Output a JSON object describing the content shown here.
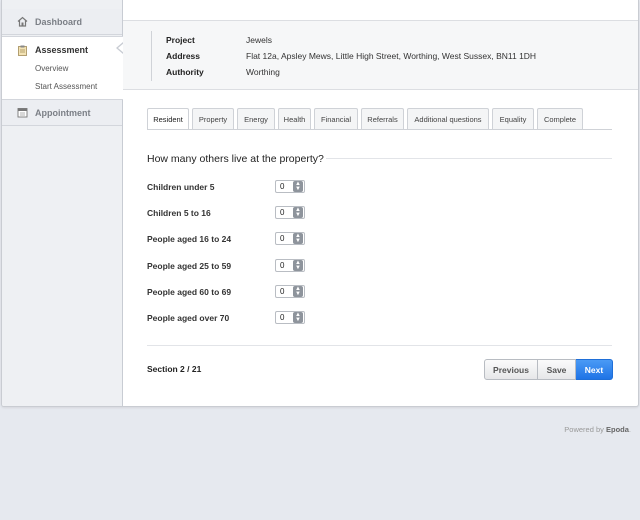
{
  "sidebar": {
    "items": [
      {
        "label": "Dashboard",
        "icon": "house-icon"
      },
      {
        "label": "Assessment",
        "icon": "clipboard-icon"
      },
      {
        "label": "Appointment",
        "icon": "calendar-icon"
      }
    ],
    "sub_items": [
      "Overview",
      "Start Assessment"
    ]
  },
  "info": {
    "project_label": "Project",
    "project_value": "Jewels",
    "address_label": "Address",
    "address_value": "Flat 12a, Apsley Mews, Little High Street, Worthing, West Sussex, BN11 1DH",
    "authority_label": "Authority",
    "authority_value": "Worthing"
  },
  "tabs": [
    "Resident",
    "Property",
    "Energy",
    "Health",
    "Financial",
    "Referrals",
    "Additional questions",
    "Equality",
    "Complete"
  ],
  "form": {
    "question": "How many others live at the property?",
    "fields": [
      {
        "label": "Children under 5",
        "value": "0"
      },
      {
        "label": "Children 5 to 16",
        "value": "0"
      },
      {
        "label": "People aged 16 to 24",
        "value": "0"
      },
      {
        "label": "People aged 25 to 59",
        "value": "0"
      },
      {
        "label": "People aged 60 to 69",
        "value": "0"
      },
      {
        "label": "People aged over 70",
        "value": "0"
      }
    ]
  },
  "footer_nav": {
    "section": "Section 2 / 21",
    "previous": "Previous",
    "save": "Save",
    "next": "Next"
  },
  "powered": {
    "prefix": "Powered by",
    "brand": "Epoda",
    "suffix": "."
  },
  "colors": {
    "accent": "#1f74e6",
    "sidebar_bg": "#eef0f3",
    "page_bg": "#e6e9ef"
  }
}
